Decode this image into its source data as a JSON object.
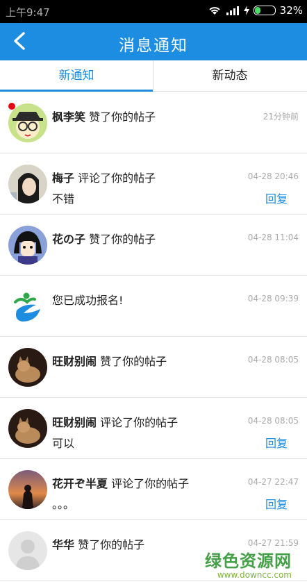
{
  "status_bar": {
    "time": "上午9:47",
    "battery": "32%",
    "battery_level": 0.32
  },
  "header": {
    "title": "消息通知"
  },
  "tabs": [
    {
      "label": "新通知"
    },
    {
      "label": "新动态"
    }
  ],
  "notifications": [
    {
      "name": "枫李笑",
      "action": "赞了你的帖子",
      "time": "21分钟前",
      "content": "",
      "reply": "",
      "unread": true
    },
    {
      "name": "梅子",
      "action": "评论了你的帖子",
      "time": "04-28 20:46",
      "content": "不错",
      "reply": "回复"
    },
    {
      "name": "花の子",
      "action": "赞了你的帖子",
      "time": "04-28 11:04",
      "content": "",
      "reply": ""
    },
    {
      "name": "",
      "action": "您已成功报名!",
      "time": "04-28 09:39",
      "content": "",
      "reply": ""
    },
    {
      "name": "旺财别闹",
      "action": "赞了你的帖子",
      "time": "04-28 08:05",
      "content": "",
      "reply": ""
    },
    {
      "name": "旺财别闹",
      "action": "评论了你的帖子",
      "time": "04-28 08:05",
      "content": "可以",
      "reply": "回复"
    },
    {
      "name": "花开ぞ半夏",
      "action": "评论了你的帖子",
      "time": "04-27 22:47",
      "content": "。。。",
      "reply": "回复"
    },
    {
      "name": "华华",
      "action": "赞了你的帖子",
      "time": "04-27 21:59",
      "content": "",
      "reply": ""
    }
  ],
  "watermark": {
    "title": "绿色资源网",
    "url": "www.downcc.com"
  },
  "colors": {
    "accent": "#1c8de0",
    "unread_dot": "#e60012"
  }
}
